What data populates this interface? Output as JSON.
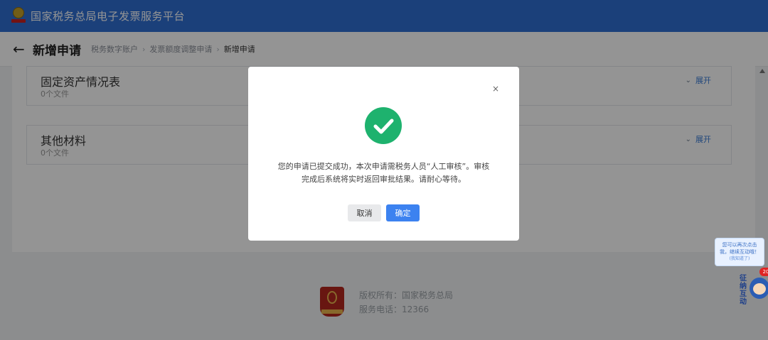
{
  "header": {
    "app_title": "国家税务总局电子发票服务平台"
  },
  "subheader": {
    "back_icon": "arrow-left-icon",
    "page_title": "新增申请",
    "breadcrumbs": [
      "税务数字账户",
      "发票额度调整申请",
      "新增申请"
    ]
  },
  "sections": [
    {
      "title": "固定资产情况表",
      "count": "0个文件",
      "expand_label": "展开"
    },
    {
      "title": "其他材料",
      "count": "0个文件",
      "expand_label": "展开"
    }
  ],
  "footer": {
    "copyright": "版权所有：国家税务总局",
    "service_phone": "服务电话：12366"
  },
  "modal": {
    "close_glyph": "×",
    "message": "您的申请已提交成功，本次申请需税务人员“人工审核”。审核完成后系统将实时返回审批结果。请耐心等待。",
    "cancel_label": "取消",
    "confirm_label": "确定",
    "accent_color": "#3c82f0",
    "success_color": "#1eb26e"
  },
  "assistant": {
    "bubble_line1": "您可以再次点击",
    "bubble_line2": "我，继续互动哦！",
    "bubble_link": "(我知道了)",
    "label": "征纳互动",
    "badge": "20"
  }
}
